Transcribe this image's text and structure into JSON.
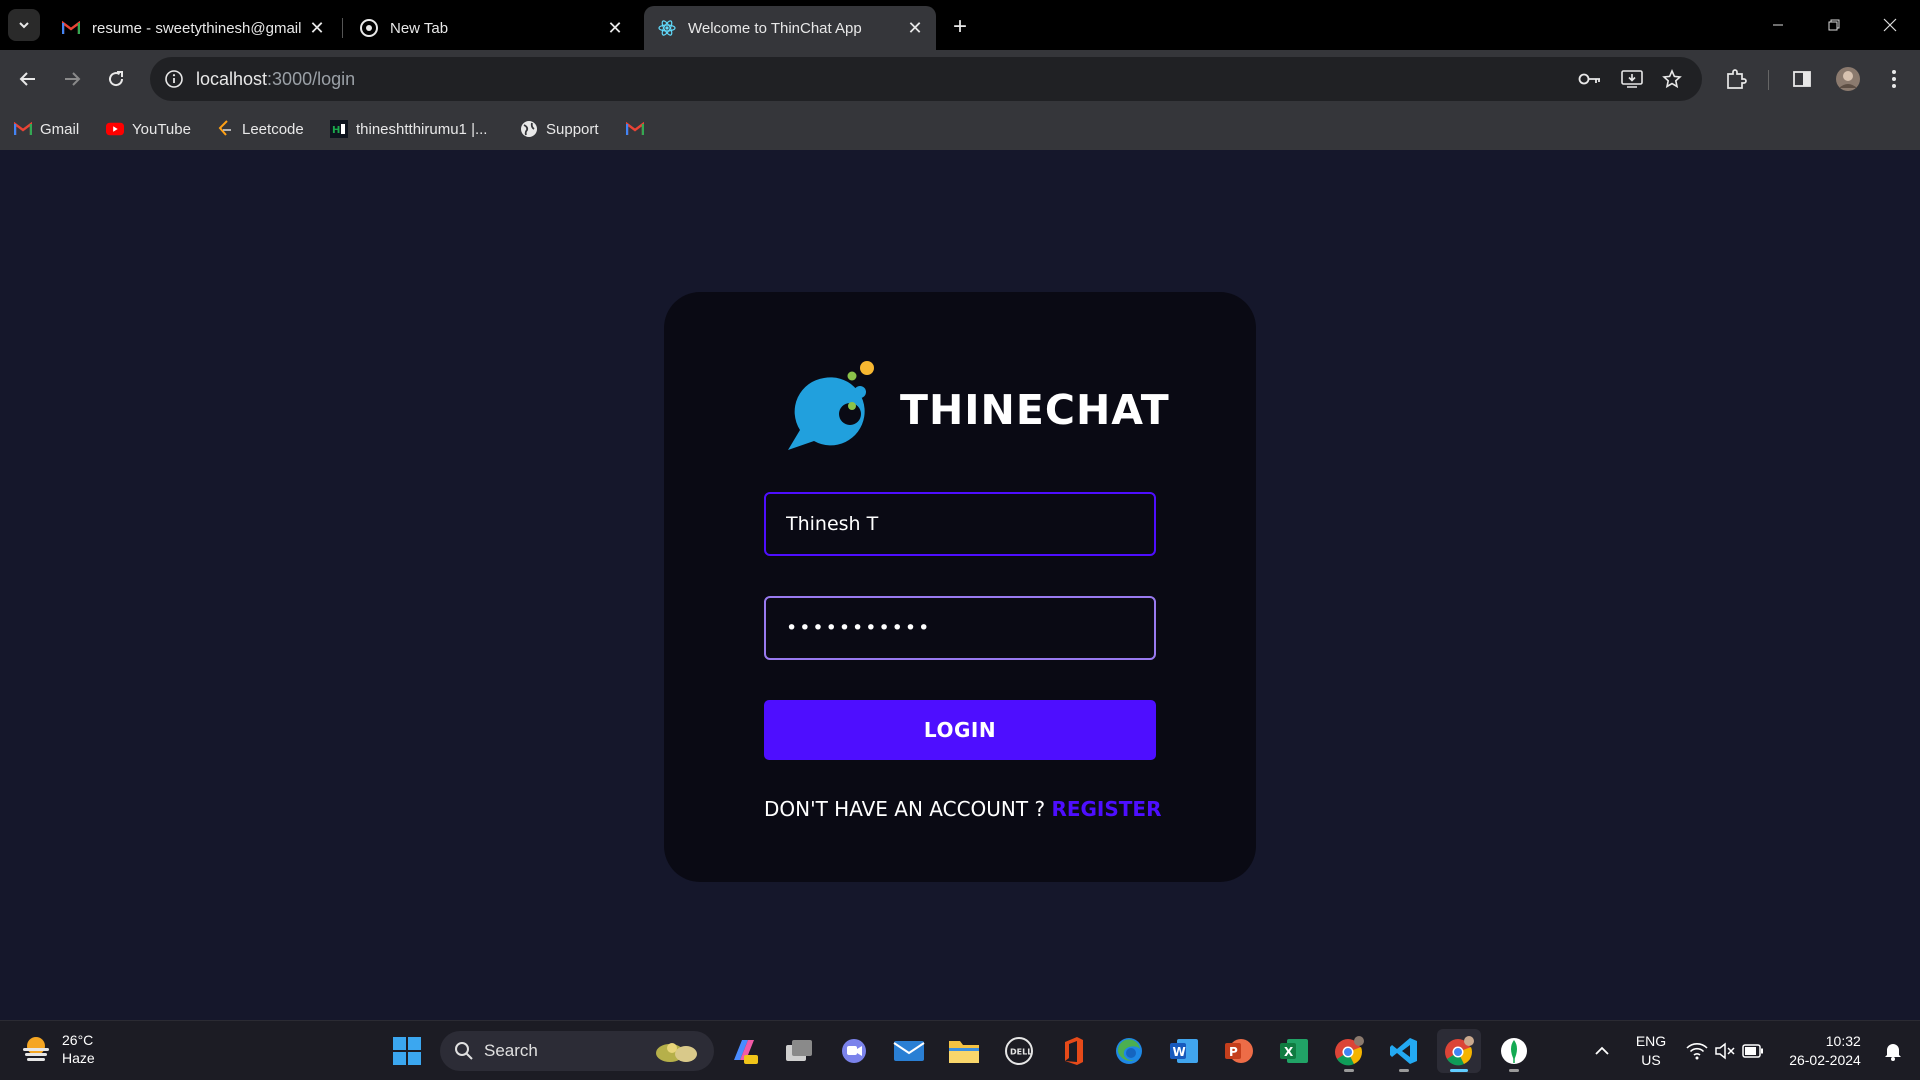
{
  "browser": {
    "tabs": [
      {
        "title": "resume - sweetythinesh@gmail",
        "favicon": "gmail-icon",
        "active": false
      },
      {
        "title": "New Tab",
        "favicon": "chrome-icon",
        "active": false
      },
      {
        "title": "Welcome to ThinChat App",
        "favicon": "react-icon",
        "active": true
      }
    ],
    "url": {
      "host": "localhost",
      "rest": ":3000/login"
    },
    "bookmarks": [
      {
        "label": "Gmail",
        "icon": "gmail-icon"
      },
      {
        "label": "YouTube",
        "icon": "youtube-icon"
      },
      {
        "label": "Leetcode",
        "icon": "leetcode-icon"
      },
      {
        "label": "thineshtthirumu1 |...",
        "icon": "hackerrank-icon"
      },
      {
        "label": "Support",
        "icon": "globe-icon"
      },
      {
        "label": "",
        "icon": "gmail-icon"
      }
    ]
  },
  "login": {
    "brand": "THINECHAT",
    "username_value": "Thinesh T",
    "password_value": "•••••••••••",
    "login_label": "LOGIN",
    "no_account_text": "DON'T HAVE AN ACCOUNT ? ",
    "register_label": "REGISTER"
  },
  "colors": {
    "accent": "#4e0eff",
    "accent_light": "#997af0",
    "page_bg": "#15172b",
    "card_bg": "#0a0a14"
  },
  "taskbar": {
    "weather": {
      "temp": "26°C",
      "condition": "Haze"
    },
    "search_label": "Search",
    "language": {
      "lang": "ENG",
      "region": "US"
    },
    "clock": {
      "time": "10:32",
      "date": "26-02-2024"
    }
  }
}
